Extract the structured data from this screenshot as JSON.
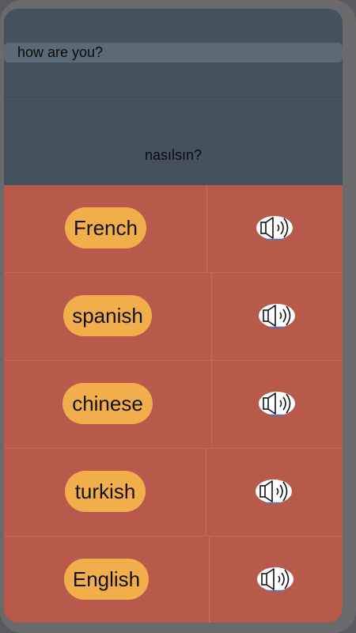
{
  "input": {
    "value": "how are you?"
  },
  "translation": {
    "text": "nasılsın?"
  },
  "languages": [
    {
      "label": "French",
      "icon": "speaker-icon"
    },
    {
      "label": "spanish",
      "icon": "speaker-icon"
    },
    {
      "label": "chinese",
      "icon": "speaker-icon"
    },
    {
      "label": "turkish",
      "icon": "speaker-icon"
    },
    {
      "label": "English",
      "icon": "speaker-icon"
    }
  ],
  "colors": {
    "header_bg": "#44525f",
    "list_bg": "#b85a4b",
    "button_bg": "#f2ae4a"
  }
}
